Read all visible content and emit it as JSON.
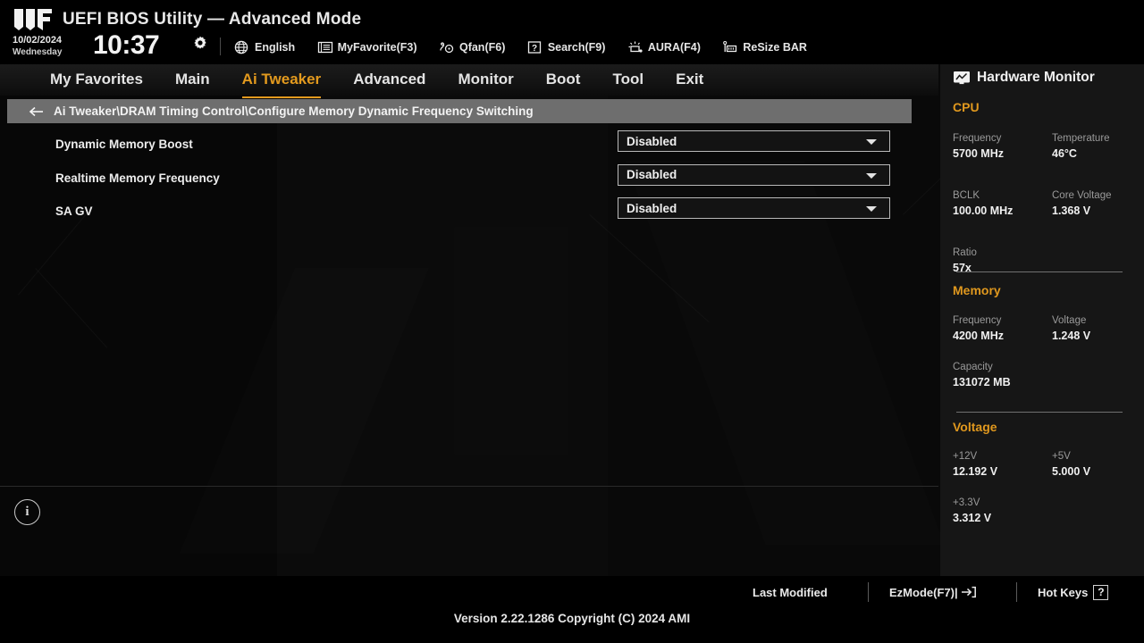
{
  "header": {
    "logo_icon": "tuf-gaming-logo",
    "title": "UEFI BIOS Utility — Advanced Mode",
    "date": "10/02/2024",
    "weekday": "Wednesday",
    "time": "10:37",
    "gear_icon": "gear-icon",
    "tools": [
      {
        "icon": "globe-icon",
        "label": "English"
      },
      {
        "icon": "myfavorite-icon",
        "label": "MyFavorite(F3)"
      },
      {
        "icon": "qfan-icon",
        "label": "Qfan(F6)"
      },
      {
        "icon": "search-icon",
        "label": "Search(F9)"
      },
      {
        "icon": "aura-icon",
        "label": "AURA(F4)"
      },
      {
        "icon": "resizebar-icon",
        "label": "ReSize BAR"
      }
    ]
  },
  "nav": {
    "items": [
      {
        "label": "My Favorites",
        "active": false
      },
      {
        "label": "Main",
        "active": false
      },
      {
        "label": "Ai Tweaker",
        "active": true
      },
      {
        "label": "Advanced",
        "active": false
      },
      {
        "label": "Monitor",
        "active": false
      },
      {
        "label": "Boot",
        "active": false
      },
      {
        "label": "Tool",
        "active": false
      },
      {
        "label": "Exit",
        "active": false
      }
    ],
    "active_color": "#e39a1e"
  },
  "breadcrumb": {
    "back_icon": "back-arrow-icon",
    "path": "Ai Tweaker\\DRAM Timing Control\\Configure Memory Dynamic Frequency Switching"
  },
  "settings": {
    "rows": [
      {
        "label": "Dynamic Memory Boost",
        "value": "Disabled"
      },
      {
        "label": "Realtime Memory Frequency",
        "value": "Disabled"
      },
      {
        "label": "SA GV",
        "value": "Disabled"
      }
    ],
    "info_icon": "info-icon",
    "info_glyph": "i"
  },
  "hardware_monitor": {
    "icon": "monitor-icon",
    "title": "Hardware Monitor",
    "accent_color": "#e0981e",
    "sections": [
      {
        "title": "CPU",
        "metrics": [
          {
            "key": "Frequency",
            "value": "5700 MHz"
          },
          {
            "key": "Temperature",
            "value": "46°C"
          },
          {
            "key": "BCLK",
            "value": "100.00 MHz"
          },
          {
            "key": "Core Voltage",
            "value": "1.368 V"
          },
          {
            "key": "Ratio",
            "value": "57x"
          }
        ]
      },
      {
        "title": "Memory",
        "metrics": [
          {
            "key": "Frequency",
            "value": "4200 MHz"
          },
          {
            "key": "Voltage",
            "value": "1.248 V"
          },
          {
            "key": "Capacity",
            "value": "131072 MB"
          }
        ]
      },
      {
        "title": "Voltage",
        "metrics": [
          {
            "key": "+12V",
            "value": "12.192 V"
          },
          {
            "key": "+5V",
            "value": "5.000 V"
          },
          {
            "key": "+3.3V",
            "value": "3.312 V"
          }
        ]
      }
    ]
  },
  "footer": {
    "last_modified": "Last Modified",
    "ezmode": "EzMode(F7)|",
    "ezmode_icon": "arrow-into-bracket-icon",
    "hotkeys": "Hot Keys",
    "hotkeys_glyph": "?",
    "version": "Version 2.22.1286 Copyright (C) 2024 AMI"
  }
}
